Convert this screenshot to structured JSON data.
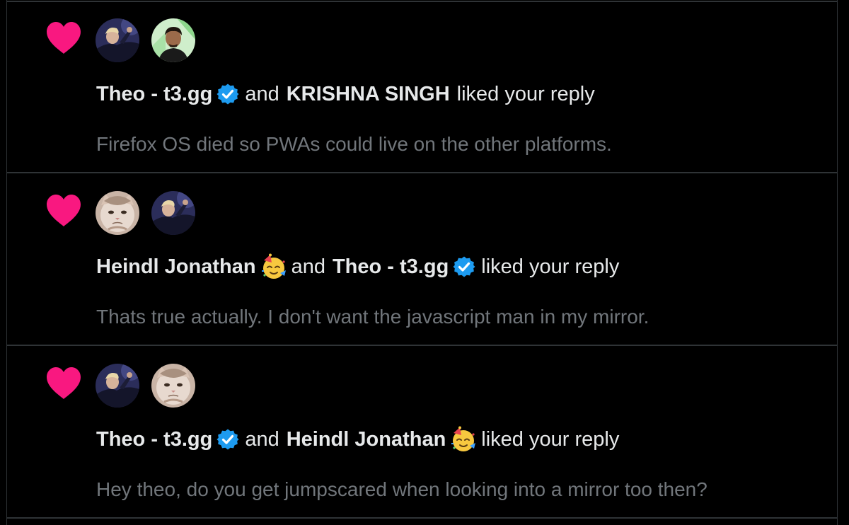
{
  "colors": {
    "background": "#000000",
    "divider": "#2f3336",
    "heart": "#f91880",
    "verified": "#1d9bf0",
    "text_primary": "#e7e9ea",
    "text_secondary": "#71767b"
  },
  "notifications": [
    {
      "icon": "heart-icon",
      "avatars": [
        "theo-avatar",
        "krishna-avatar"
      ],
      "user1": "Theo - t3.gg",
      "user1_verified": true,
      "connector": "and",
      "user2": "KRISHNA SINGH",
      "user2_verified": false,
      "action": "liked your reply",
      "reply_text": "Firefox OS died so PWAs could live on the other platforms."
    },
    {
      "icon": "heart-icon",
      "avatars": [
        "cat-avatar",
        "theo-avatar"
      ],
      "user1": "Heindl Jonathan",
      "user1_emoji": "partying-face-emoji",
      "connector": "and",
      "user2": "Theo - t3.gg",
      "user2_verified": true,
      "action": "liked your reply",
      "reply_text": "Thats true actually. I don't want the javascript man in my mirror."
    },
    {
      "icon": "heart-icon",
      "avatars": [
        "theo-avatar",
        "cat-avatar"
      ],
      "user1": "Theo - t3.gg",
      "user1_verified": true,
      "connector": "and",
      "user2": "Heindl Jonathan",
      "user2_emoji": "partying-face-emoji",
      "action": "liked your reply",
      "reply_text": "Hey theo, do you get jumpscared when looking into a mirror too then?"
    }
  ]
}
